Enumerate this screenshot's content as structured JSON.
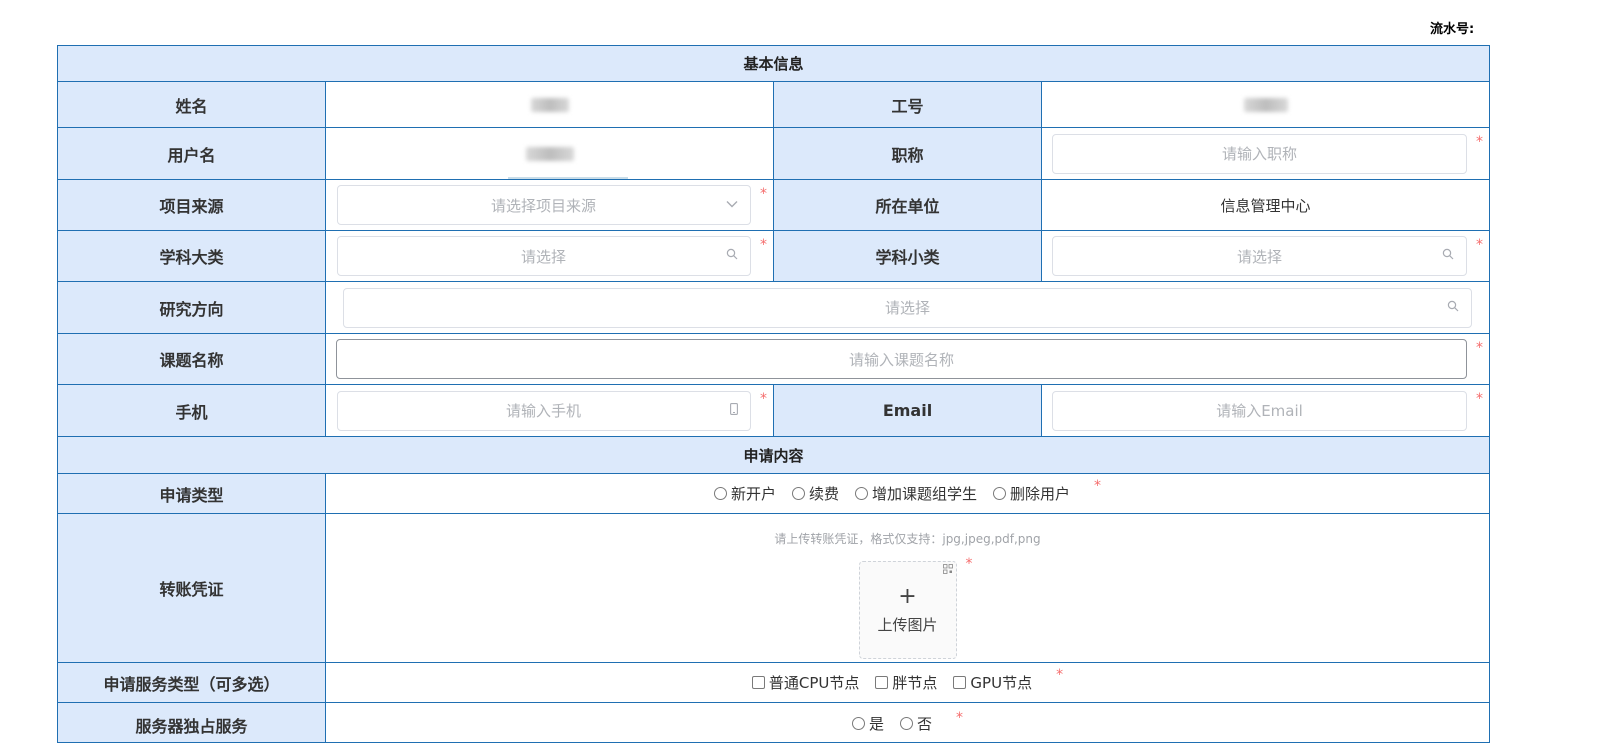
{
  "serial_label": "流水号:",
  "sections": {
    "basic": "基本信息",
    "apply": "申请内容"
  },
  "fields": {
    "name": {
      "label": "姓名"
    },
    "employee_id": {
      "label": "工号"
    },
    "username": {
      "label": "用户名"
    },
    "title": {
      "label": "职称",
      "placeholder": "请输入职称"
    },
    "project_source": {
      "label": "项目来源",
      "placeholder": "请选择项目来源"
    },
    "unit": {
      "label": "所在单位",
      "value": "信息管理中心"
    },
    "major_category": {
      "label": "学科大类",
      "placeholder": "请选择"
    },
    "minor_category": {
      "label": "学科小类",
      "placeholder": "请选择"
    },
    "research_direction": {
      "label": "研究方向",
      "placeholder": "请选择"
    },
    "topic_name": {
      "label": "课题名称",
      "placeholder": "请输入课题名称"
    },
    "phone": {
      "label": "手机",
      "placeholder": "请输入手机"
    },
    "email": {
      "label": "Email",
      "placeholder": "请输入Email"
    },
    "apply_type": {
      "label": "申请类型",
      "options": [
        "新开户",
        "续费",
        "增加课题组学生",
        "删除用户"
      ]
    },
    "voucher": {
      "label": "转账凭证",
      "hint": "请上传转账凭证，格式仅支持：jpg,jpeg,pdf,png",
      "upload_plus": "+",
      "upload_text": "上传图片"
    },
    "service_type": {
      "label": "申请服务类型（可多选）",
      "options": [
        "普通CPU节点",
        "胖节点",
        "GPU节点"
      ]
    },
    "extra_service": {
      "label": "服务器独占服务",
      "options": [
        "是",
        "否"
      ]
    }
  },
  "required_mark": "*",
  "icons": {
    "dropdown": "chevron-down-icon",
    "search": "search-icon",
    "phone": "mobile-icon",
    "upload_corner": "qr-icon"
  }
}
